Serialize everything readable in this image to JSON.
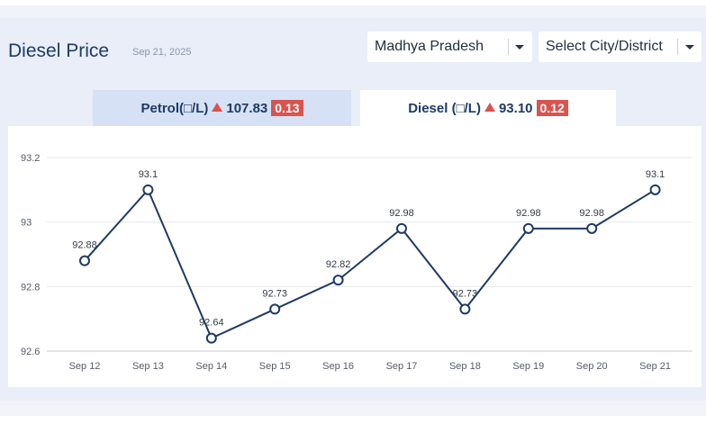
{
  "header": {
    "title": "Diesel Price",
    "date": "Sep 21, 2025"
  },
  "filters": {
    "state": {
      "value": "Madhya Pradesh",
      "icon": "chevron-down-icon"
    },
    "city": {
      "value": "Select City/District",
      "icon": "chevron-down-icon"
    }
  },
  "tabs": [
    {
      "label": "Petrol(□/L)",
      "price": "107.83",
      "change": "0.13",
      "trend_icon": "up-triangle-icon",
      "active": false
    },
    {
      "label": "Diesel (□/L)",
      "price": "93.10",
      "change": "0.12",
      "trend_icon": "up-triangle-icon",
      "active": true
    }
  ],
  "colors": {
    "accent": "#1f3a63",
    "change_badge": "#d9534f",
    "line": "#1f3a63"
  },
  "chart_data": {
    "type": "line",
    "title": "",
    "xlabel": "",
    "ylabel": "",
    "categories": [
      "Sep 12",
      "Sep 13",
      "Sep 14",
      "Sep 15",
      "Sep 16",
      "Sep 17",
      "Sep 18",
      "Sep 19",
      "Sep 20",
      "Sep 21"
    ],
    "values": [
      92.88,
      93.1,
      92.64,
      92.73,
      92.82,
      92.98,
      92.73,
      92.98,
      92.98,
      93.1
    ],
    "data_labels": [
      "92.88",
      "93.1",
      "92.64",
      "92.73",
      "92.82",
      "92.98",
      "92.73",
      "92.98",
      "92.98",
      "93.1"
    ],
    "ylim": [
      92.6,
      93.2
    ],
    "yticks": [
      "92.6",
      "92.8",
      "93",
      "93.2"
    ],
    "grid": true,
    "legend": "none"
  }
}
